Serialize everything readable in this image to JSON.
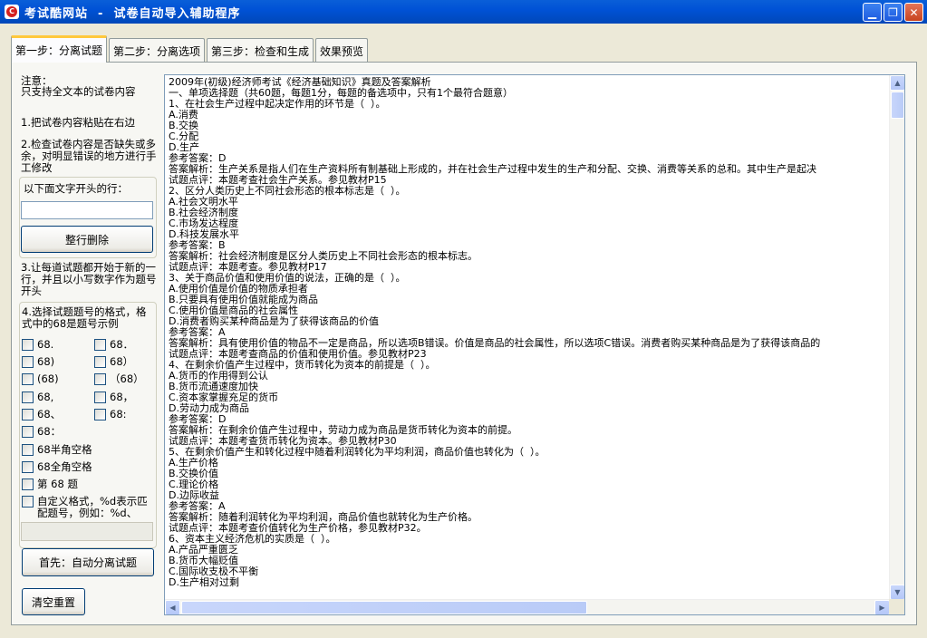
{
  "window": {
    "title": "考试酷网站  -  试卷自动导入辅助程序",
    "icon_text": "C"
  },
  "tabs": [
    {
      "label": "第一步：分离试题"
    },
    {
      "label": "第二步：分离选项"
    },
    {
      "label": "第三步：检查和生成"
    },
    {
      "label": "效果预览"
    }
  ],
  "left": {
    "note_title": "注意：",
    "note_text": "只支持全文本的试卷内容",
    "step1": "1.把试卷内容粘贴在右边",
    "step2": "2.检查试卷内容是否缺失或多余，对明显错误的地方进行手工修改",
    "prefix_label": "以下面文字开头的行：",
    "prefix_value": "",
    "delete_button": "整行删除",
    "step3": "3.让每道试题都开始于新的一行，并且以小写数字作为题号开头",
    "step4": "4.选择试题题号的格式，格式中的68是题号示例",
    "formats": [
      "68.",
      "68．",
      "68)",
      "68）",
      "(68)",
      "（68）",
      "68,",
      "68，",
      "68、",
      "68:",
      "68："
    ],
    "format_half": "68半角空格",
    "format_full": "68全角空格",
    "format_di": "第 68 题",
    "format_custom": "自定义格式，%d表示匹配题号，例如：%d、",
    "custom_value": "",
    "auto_button": "首先：自动分离试题",
    "reset_button": "清空重置"
  },
  "editor": {
    "lines": [
      "2009年(初级)经济师考试《经济基础知识》真题及答案解析",
      "一、单项选择题（共60题，每题1分，每题的备选项中，只有1个最符合题意）",
      "1、在社会生产过程中起决定作用的环节是（  ）。",
      "A.消费",
      "B.交换",
      "C.分配",
      "D.生产",
      "参考答案：D",
      "答案解析：生产关系是指人们在生产资料所有制基础上形成的，并在社会生产过程中发生的生产和分配、交换、消费等关系的总和。其中生产是起决",
      "试题点评：本题考查社会生产关系。参见教材P15",
      "2、区分人类历史上不同社会形态的根本标志是（  ）。",
      "A.社会文明水平",
      "B.社会经济制度",
      "C.市场发达程度",
      "D.科技发展水平",
      "参考答案：B",
      "答案解析：社会经济制度是区分人类历史上不同社会形态的根本标志。",
      "试题点评：本题考查。参见教材P17",
      "3、关于商品价值和使用价值的说法，正确的是（  ）。",
      "A.使用价值是价值的物质承担者",
      "B.只要具有使用价值就能成为商品",
      "C.使用价值是商品的社会属性",
      "D.消费者购买某种商品是为了获得该商品的价值",
      "参考答案：A",
      "答案解析：具有使用价值的物品不一定是商品，所以选项B错误。价值是商品的社会属性，所以选项C错误。消费者购买某种商品是为了获得该商品的",
      "试题点评：本题考查商品的价值和使用价值。参见教材P23",
      "4、在剩余价值产生过程中，货币转化为资本的前提是（  ）。",
      "A.货币的作用得到公认",
      "B.货币流通速度加快",
      "C.资本家掌握充足的货币",
      "D.劳动力成为商品",
      "参考答案：D",
      "答案解析：在剩余价值产生过程中，劳动力成为商品是货币转化为资本的前提。",
      "试题点评：本题考查货币转化为资本。参见教材P30",
      "5、在剩余价值产生和转化过程中随着利润转化为平均利润，商品价值也转化为（  ）。",
      "A.生产价格",
      "B.交换价值",
      "C.理论价格",
      "D.边际收益",
      "参考答案：A",
      "答案解析：随着利润转化为平均利润，商品价值也就转化为生产价格。",
      "试题点评：本题考查价值转化为生产价格，参见教材P32。",
      "6、资本主义经济危机的实质是（  ）。",
      "A.产品严重匮乏",
      "B.货币大幅贬值",
      "C.国际收支极不平衡",
      "D.生产相对过剩"
    ]
  }
}
